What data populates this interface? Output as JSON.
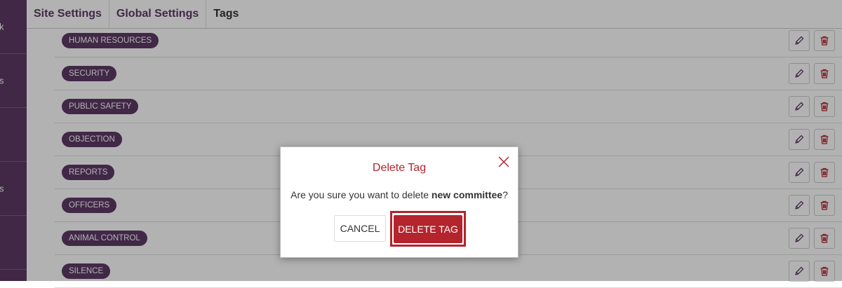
{
  "sidebar": {
    "items": [
      {
        "label": "k"
      },
      {
        "label": "s"
      },
      {
        "label": ""
      },
      {
        "label": "s"
      },
      {
        "label": ""
      }
    ]
  },
  "header": {
    "tabs": [
      {
        "label": "Site Settings"
      },
      {
        "label": "Global Settings"
      },
      {
        "label": "Tags"
      }
    ]
  },
  "tags": [
    {
      "name": "HUMAN RESOURCES"
    },
    {
      "name": "SECURITY"
    },
    {
      "name": "PUBLIC SAFETY"
    },
    {
      "name": "OBJECTION"
    },
    {
      "name": "REPORTS"
    },
    {
      "name": "OFFICERS"
    },
    {
      "name": "ANIMAL CONTROL"
    },
    {
      "name": "SILENCE"
    }
  ],
  "row_actions": {
    "edit_icon": "pencil-icon",
    "delete_icon": "trash-icon"
  },
  "modal": {
    "title": "Delete Tag",
    "message_prefix": "Are you sure you want to delete ",
    "tag_name": "new committee",
    "message_suffix": "?",
    "cancel_label": "CANCEL",
    "delete_label": "DELETE TAG",
    "close_icon": "close-icon"
  },
  "colors": {
    "brand_purple": "#5d3a66",
    "danger_red": "#b3242d"
  }
}
